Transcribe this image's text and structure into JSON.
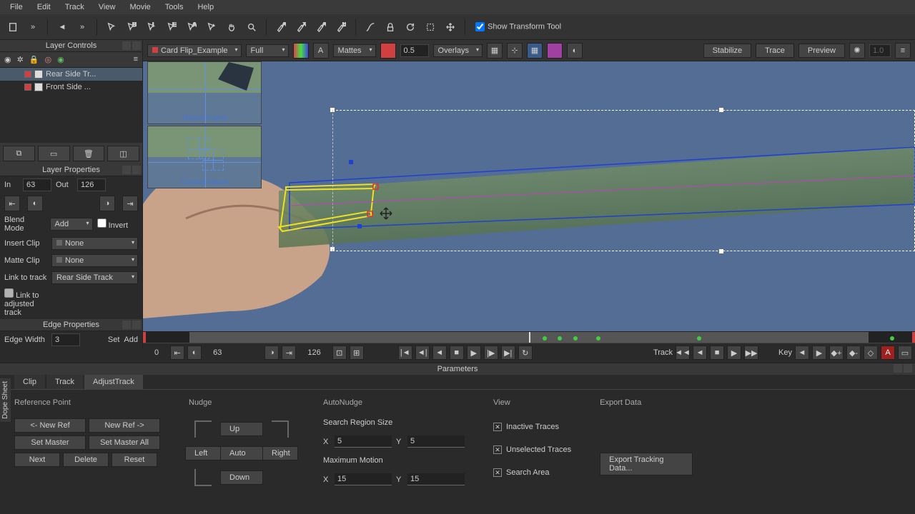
{
  "menu": {
    "file": "File",
    "edit": "Edit",
    "track": "Track",
    "view": "View",
    "movie": "Movie",
    "tools": "Tools",
    "help": "Help"
  },
  "toolbar": {
    "show_transform": "Show Transform Tool"
  },
  "secondbar": {
    "clip_name": "Card Flip_Example",
    "res": "Full",
    "mattes": "Mattes",
    "opacity": "0.5",
    "overlays": "Overlays",
    "stabilize": "Stabilize",
    "trace": "Trace",
    "preview": "Preview",
    "bright_val": "1.0"
  },
  "layers": {
    "title": "Layer Controls",
    "items": [
      {
        "name": "Rear Side Tr...",
        "color": "#d04040"
      },
      {
        "name": "Front Side ...",
        "color": "#d04040"
      }
    ]
  },
  "layer_props": {
    "title": "Layer Properties",
    "in_label": "In",
    "in_val": "63",
    "out_label": "Out",
    "out_val": "126",
    "blend_label": "Blend Mode",
    "blend_val": "Add",
    "invert": "Invert",
    "insert_label": "Insert Clip",
    "insert_val": "None",
    "matte_label": "Matte Clip",
    "matte_val": "None",
    "link_label": "Link to track",
    "link_val": "Rear Side Track",
    "link_adj": "Link to adjusted track"
  },
  "edge_props": {
    "title": "Edge Properties",
    "width_label": "Edge Width",
    "width_val": "3",
    "set": "Set",
    "add": "Add"
  },
  "viewport": {
    "master_label": "Master Frame",
    "current_label": "Current Frame"
  },
  "timeline": {
    "f_in": "63",
    "f_out": "126",
    "f_first": "0",
    "track_label": "Track",
    "key_label": "Key"
  },
  "params": {
    "title": "Parameters",
    "tabs": {
      "clip": "Clip",
      "track": "Track",
      "adjust": "AdjustTrack"
    },
    "ref_head": "Reference Point",
    "nudge_head": "Nudge",
    "auto_head": "AutoNudge",
    "view_head": "View",
    "export_head": "Export Data",
    "new_ref_l": "<- New Ref",
    "new_ref_r": "New Ref ->",
    "set_master": "Set Master",
    "set_master_all": "Set Master All",
    "next": "Next",
    "delete": "Delete",
    "reset": "Reset",
    "up": "Up",
    "down": "Down",
    "left": "Left",
    "right": "Right",
    "auto": "Auto",
    "srs": "Search Region Size",
    "mm": "Maximum Motion",
    "x": "X",
    "y": "Y",
    "srs_x": "5",
    "srs_y": "5",
    "mm_x": "15",
    "mm_y": "15",
    "inactive": "Inactive Traces",
    "unselected": "Unselected Traces",
    "search": "Search Area",
    "export_btn": "Export Tracking Data..."
  },
  "dope": "Dope Sheet"
}
